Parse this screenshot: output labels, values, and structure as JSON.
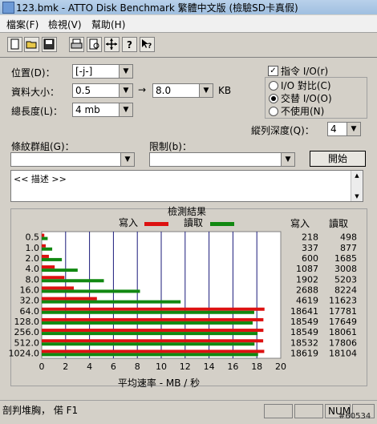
{
  "window": {
    "title": "123.bmk - ATTO Disk Benchmark  繁體中文版 (檢驗SD卡真假)"
  },
  "menu": {
    "file": "檔案(F)",
    "view": "檢視(V)",
    "help": "幫助(H)"
  },
  "toolbar": {
    "icons": [
      "new-icon",
      "open-icon",
      "save-icon",
      "print-icon",
      "print-preview-icon",
      "move-icon",
      "help-icon",
      "context-help-icon"
    ]
  },
  "settings": {
    "drive_label": "位置(D)：",
    "drive_value": "[-j-]",
    "transfer_label": "資料大小：",
    "transfer_from": "0.5",
    "transfer_to": "8.0",
    "transfer_unit": "KB",
    "length_label": "總長度(L)：",
    "length_value": "4 mb",
    "direct_io_label": "指令 I/O(r)",
    "io_compare_label": "I/O 對比(C)",
    "overlapped_io_label": "交替 I/O(O)",
    "neither_label": "不使用(N)",
    "queue_label": "縱列深度(Q)：",
    "queue_value": "4",
    "controlled_label": "條紋群組(G)：",
    "restrict_label": "限制(b)：",
    "start_button": "開始",
    "description_text": "<< 描述 >>"
  },
  "results": {
    "title": "檢測結果",
    "write_legend": "寫入",
    "read_legend": "讀取",
    "write_header": "寫入",
    "read_header": "讀取",
    "xlabel": "平均速率 - MB / 秒",
    "write_color": "#dd1111",
    "read_color": "#118811"
  },
  "chart_data": {
    "type": "bar",
    "categories": [
      "0.5",
      "1.0",
      "2.0",
      "4.0",
      "8.0",
      "16.0",
      "32.0",
      "64.0",
      "128.0",
      "256.0",
      "512.0",
      "1024.0"
    ],
    "series": [
      {
        "name": "寫入",
        "values": [
          0.218,
          0.337,
          0.6,
          1.087,
          1.902,
          2.688,
          4.619,
          18.641,
          18.549,
          18.549,
          18.532,
          18.619
        ],
        "kb_values": [
          218,
          337,
          600,
          1087,
          1902,
          2688,
          4619,
          18641,
          18549,
          18549,
          18532,
          18619
        ]
      },
      {
        "name": "讀取",
        "values": [
          0.498,
          0.877,
          1.685,
          3.008,
          5.203,
          8.224,
          11.623,
          17.781,
          17.649,
          18.061,
          17.806,
          18.104
        ],
        "kb_values": [
          498,
          877,
          1685,
          3008,
          5203,
          8224,
          11623,
          17781,
          17649,
          18061,
          17806,
          18104
        ]
      }
    ],
    "xlim": [
      0,
      20
    ],
    "xticks": [
      "0",
      "2",
      "4",
      "6",
      "8",
      "10",
      "12",
      "14",
      "16",
      "18",
      "20"
    ],
    "xlabel": "平均速率 - MB / 秒"
  },
  "status": {
    "help_text": "剖判堆胸，  偌 F1",
    "num": "NUM",
    "watermark": "#60534"
  }
}
